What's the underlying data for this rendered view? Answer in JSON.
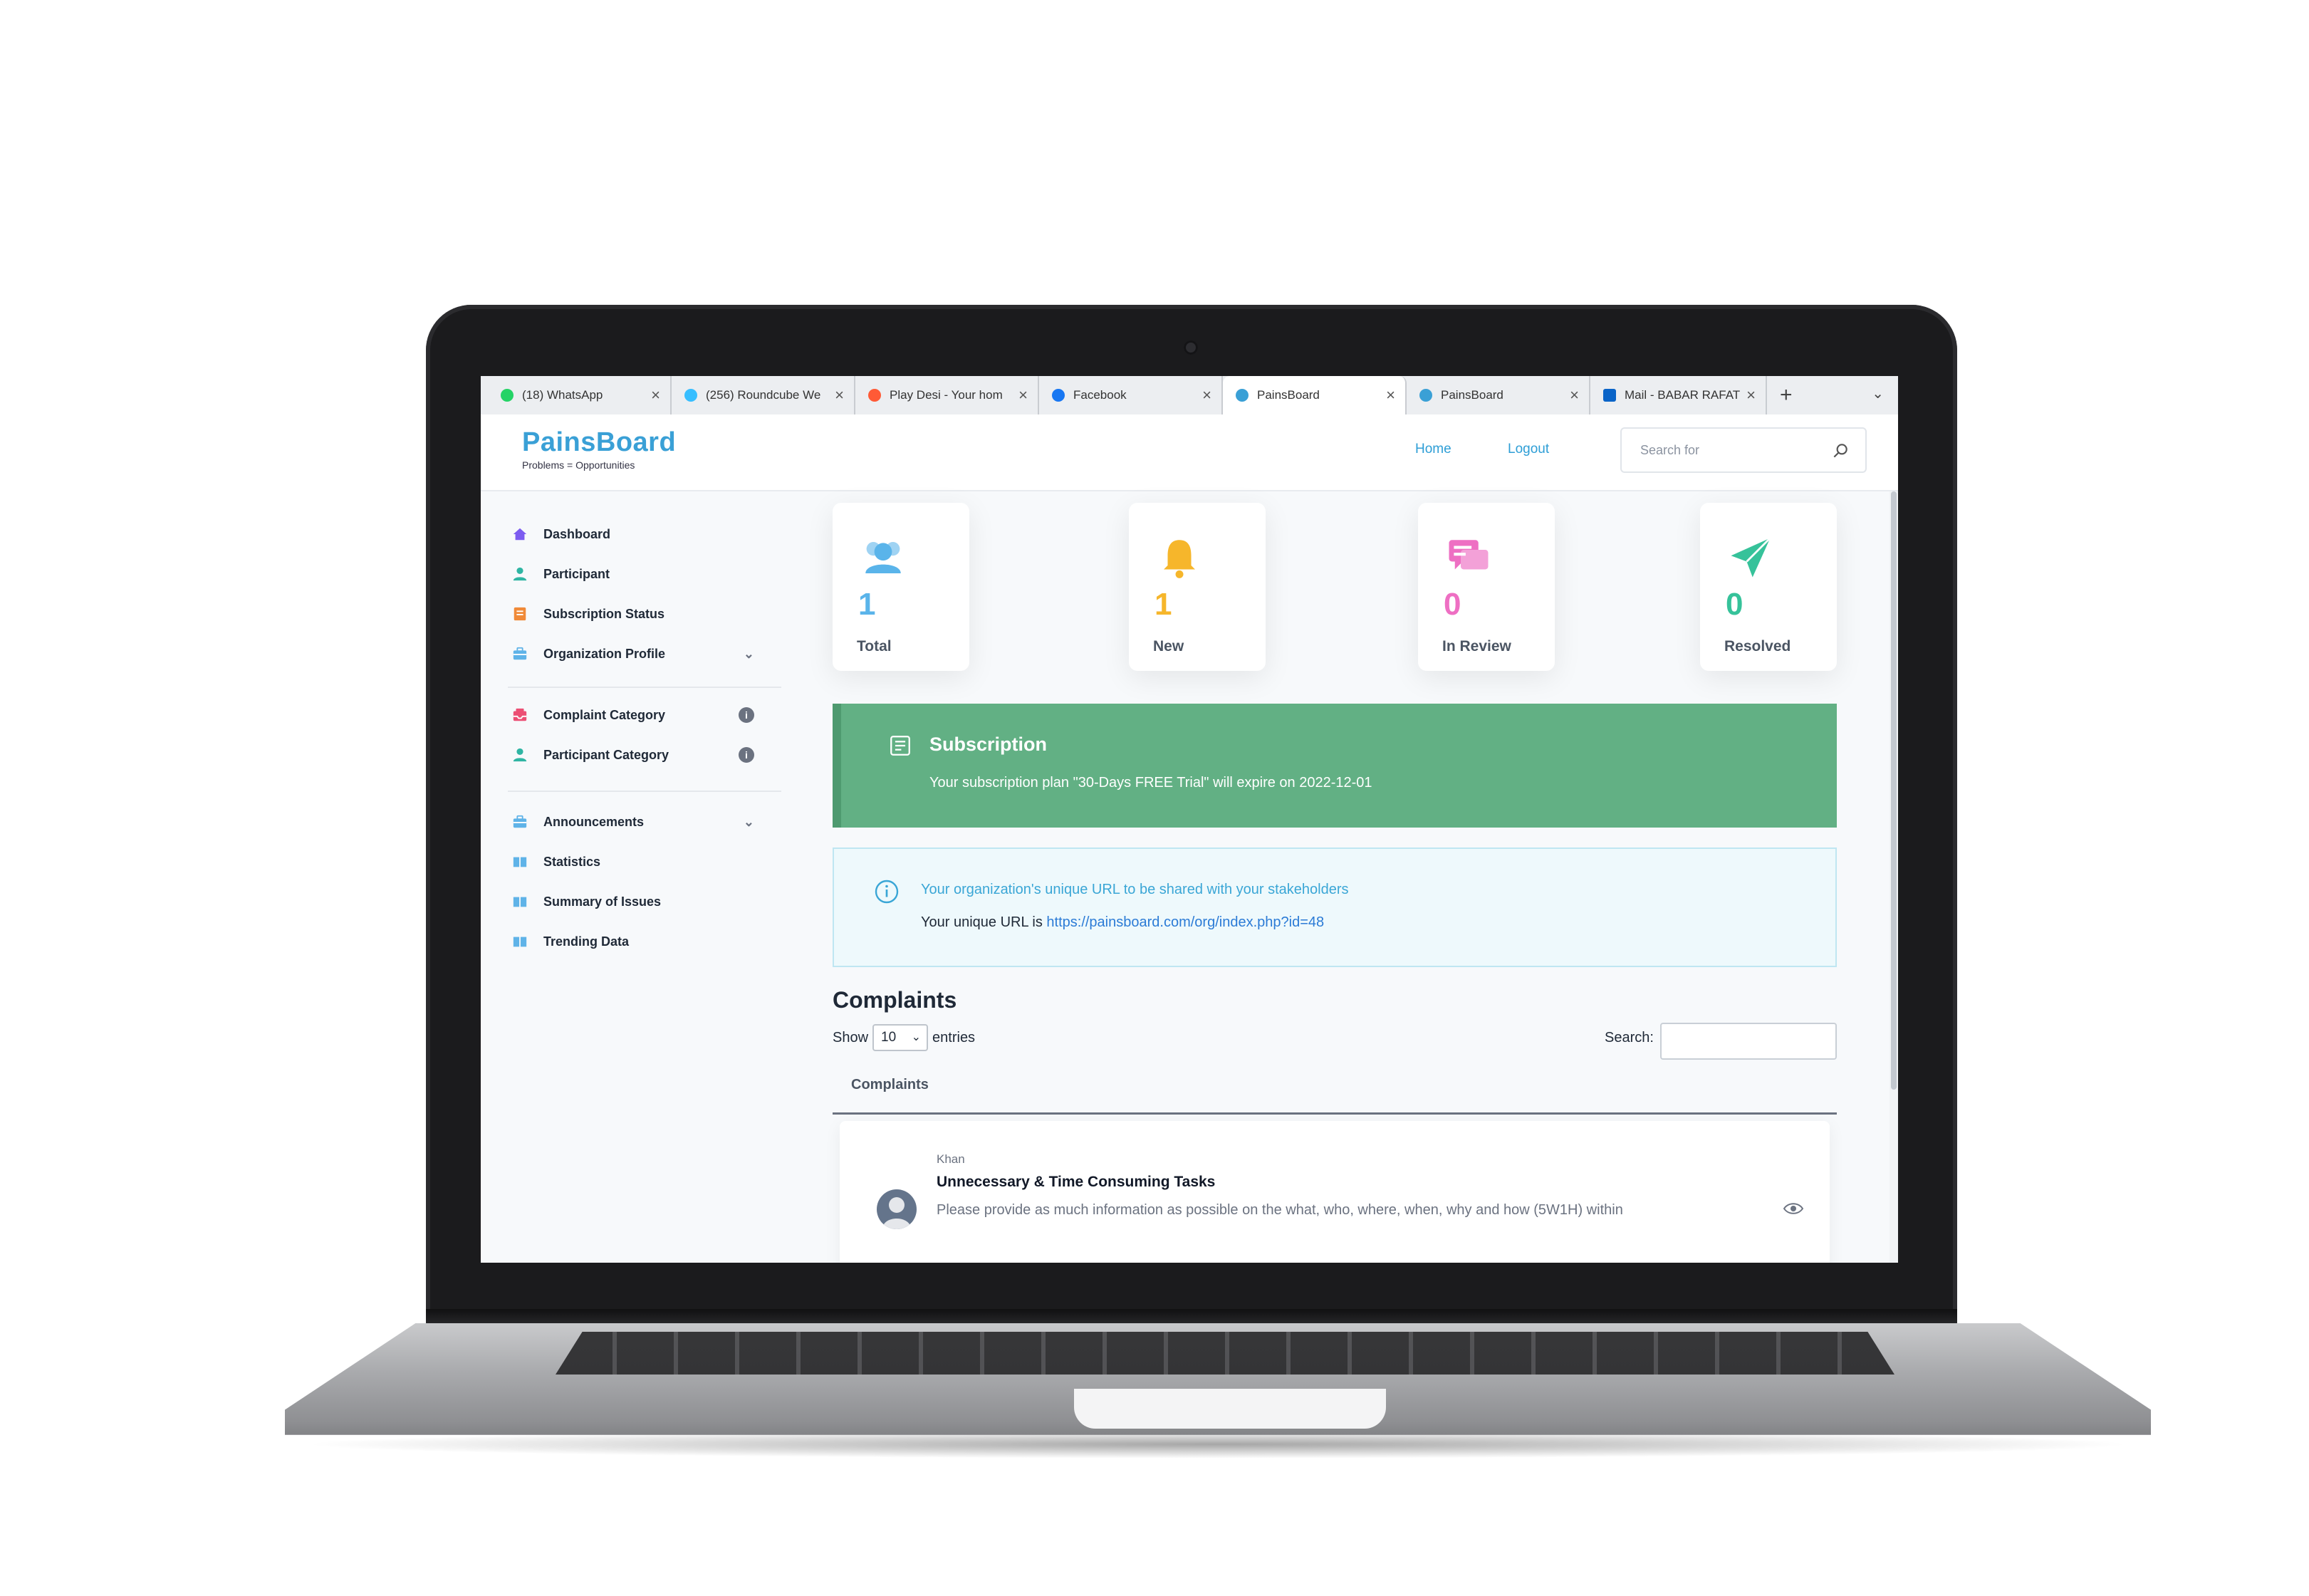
{
  "browser": {
    "tabs": [
      {
        "label": "(18) WhatsApp",
        "icon": "whatsapp-icon",
        "color": "#25d366",
        "active": false
      },
      {
        "label": "(256) Roundcube We",
        "icon": "roundcube-icon",
        "color": "#37beff",
        "active": false
      },
      {
        "label": "Play Desi - Your hom",
        "icon": "playdesi-icon",
        "color": "#ff5a36",
        "active": false
      },
      {
        "label": "Facebook",
        "icon": "facebook-icon",
        "color": "#1877f2",
        "active": false
      },
      {
        "label": "PainsBoard",
        "icon": "painsboard-icon",
        "color": "#3aa0d6",
        "active": true
      },
      {
        "label": "PainsBoard",
        "icon": "painsboard-icon",
        "color": "#3aa0d6",
        "active": false
      },
      {
        "label": "Mail - BABAR RAFAT",
        "icon": "outlook-icon",
        "color": "#0a64c8",
        "active": false
      }
    ],
    "close_glyph": "×",
    "new_tab_glyph": "+",
    "dropdown_glyph": "⌄"
  },
  "header": {
    "logo_title": "PainsBoard",
    "logo_tagline": "Problems = Opportunities",
    "nav_home": "Home",
    "nav_logout": "Logout",
    "search_placeholder": "Search for"
  },
  "sidebar": {
    "items": [
      {
        "label": "Dashboard",
        "icon": "home-icon",
        "color": "#7c5cf0"
      },
      {
        "label": "Participant",
        "icon": "user-icon",
        "color": "#2fb5a3"
      },
      {
        "label": "Subscription Status",
        "icon": "document-icon",
        "color": "#f08a38"
      },
      {
        "label": "Organization Profile",
        "icon": "briefcase-icon",
        "color": "#5fb3e8",
        "right": "⌄"
      },
      {
        "label": "Complaint Category",
        "icon": "inbox-icon",
        "color": "#ec4f74",
        "right": "i"
      },
      {
        "label": "Participant Category",
        "icon": "user-icon",
        "color": "#2fb5a3",
        "right": "i"
      },
      {
        "label": "Announcements",
        "icon": "briefcase-icon",
        "color": "#5fb3e8",
        "right": "⌄"
      },
      {
        "label": "Statistics",
        "icon": "book-icon",
        "color": "#5fb3e8"
      },
      {
        "label": "Summary of Issues",
        "icon": "book-icon",
        "color": "#5fb3e8"
      },
      {
        "label": "Trending Data",
        "icon": "book-icon",
        "color": "#5fb3e8"
      }
    ]
  },
  "stats": [
    {
      "value": "1",
      "label": "Total",
      "icon": "users-icon",
      "color": "#5ab4ea"
    },
    {
      "value": "1",
      "label": "New",
      "icon": "bell-icon",
      "color": "#f6b62b"
    },
    {
      "value": "0",
      "label": "In Review",
      "icon": "chat-icon",
      "color": "#ee6fc3"
    },
    {
      "value": "0",
      "label": "Resolved",
      "icon": "paper-plane-icon",
      "color": "#36c29a"
    }
  ],
  "subscription": {
    "title": "Subscription",
    "text": "Your subscription plan \"30-Days FREE Trial\" will expire on 2022-12-01",
    "color": "#62b084"
  },
  "url_notice": {
    "title": "Your organization's unique URL to be shared with your stakeholders",
    "prefix": "Your unique URL is ",
    "url": "https://painsboard.com/org/index.php?id=48"
  },
  "complaints": {
    "heading": "Complaints",
    "show_label": "Show",
    "entries_value": "10",
    "entries_label": "entries",
    "search_label": "Search:",
    "column_header": "Complaints",
    "rows": [
      {
        "author": "Khan",
        "title": "Unnecessary & Time Consuming Tasks",
        "description": "Please provide as much information as possible on the what, who, where, when, why and how (5W1H) within"
      }
    ]
  }
}
